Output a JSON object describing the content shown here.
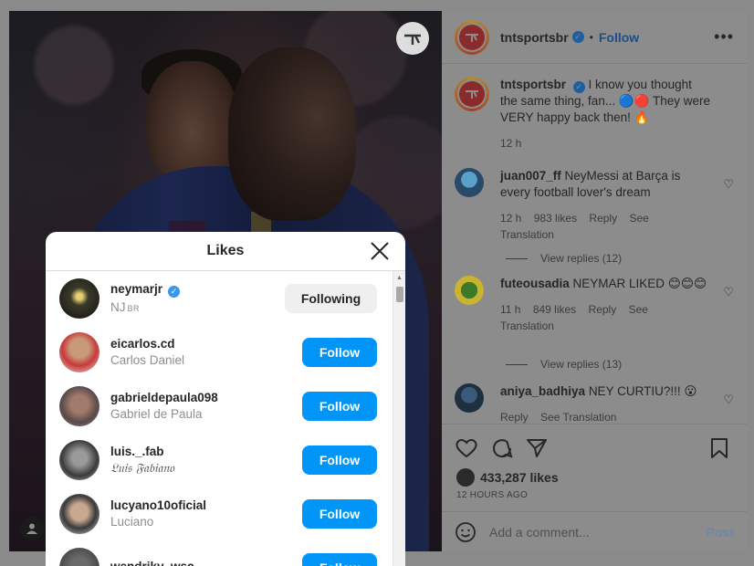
{
  "post": {
    "account": "tntsportsbr",
    "follow_label": "Follow",
    "caption_user": "tntsportsbr",
    "caption_text": "I know you thought the same thing, fan... 🔵🔴 They were VERY happy back then! 🔥",
    "caption_time": "12 h"
  },
  "comments": [
    {
      "user": "juan007_ff",
      "text": "NeyMessi at Barça is every football lover's dream",
      "time": "12 h",
      "likes": "983 likes",
      "reply": "Reply",
      "translate": "See Translation",
      "view_replies": "View replies (12)"
    },
    {
      "user": "futeousadia",
      "text": "NEYMAR LIKED 😊😊😊",
      "time": "11 h",
      "likes": "849 likes",
      "reply": "Reply",
      "translate": "See Translation",
      "view_replies": "View replies (13)"
    },
    {
      "user": "aniya_badhiya",
      "text": "NEY CURTIU?!!! 😮",
      "time": "",
      "likes": "",
      "reply": "Reply",
      "translate": "See Translation",
      "view_replies": ""
    }
  ],
  "actions": {
    "likes_count": "433,287 likes",
    "time_ago": "12 HOURS AGO",
    "comment_placeholder": "Add a comment...",
    "post_label": "Post"
  },
  "likes_modal": {
    "title": "Likes",
    "users": [
      {
        "username": "neymarjr",
        "fullname": "NJ",
        "fullname_suffix": "BR",
        "verified": true,
        "button": "Following"
      },
      {
        "username": "eicarlos.cd",
        "fullname": "Carlos Daniel",
        "button": "Follow"
      },
      {
        "username": "gabrieldepaula098",
        "fullname": "Gabriel de Paula",
        "button": "Follow"
      },
      {
        "username": "luis._.fab",
        "fullname": "𝔏𝔲𝔦𝔰 𝔉𝔞𝔟𝔦𝔞𝔫𝔬",
        "button": "Follow"
      },
      {
        "username": "lucyano10oficial",
        "fullname": "Luciano",
        "button": "Follow"
      },
      {
        "username": "wendriky_wsc",
        "fullname": "",
        "button": "Follow"
      }
    ]
  },
  "icons": [
    "tnt-logo-icon",
    "user-tag-icon",
    "more-icon",
    "verified-icon",
    "heart-icon",
    "comment-icon",
    "share-icon",
    "bookmark-icon",
    "smile-icon",
    "close-icon"
  ]
}
